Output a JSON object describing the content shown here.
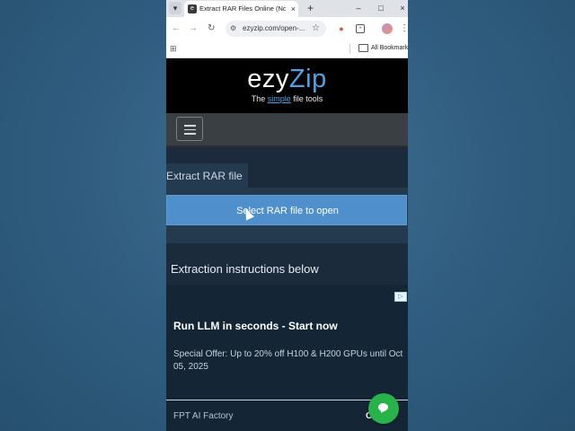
{
  "browser": {
    "tab": {
      "favicon_text": "e",
      "title": "Extract RAR Files Online (No Re",
      "close_glyph": "×"
    },
    "new_tab_glyph": "+",
    "window_controls": {
      "minimize": "–",
      "maximize": "□",
      "close": "×"
    },
    "address": {
      "url": "ezyzip.com/open-..."
    },
    "bookmarks": {
      "all_bookmarks_label": "All Bookmarks"
    }
  },
  "site": {
    "logo": {
      "ezy": "ezy",
      "zip": "Zip"
    },
    "tagline": {
      "prefix": "The ",
      "simple": "simple",
      "suffix": " file tools"
    },
    "tab_label": "Extract RAR file",
    "select_button_label": "Select RAR file to open",
    "instructions_heading": "Extraction instructions below"
  },
  "ad": {
    "title": "Run LLM in seconds - Start now",
    "body": "Special Offer: Up to 20% off H100 & H200 GPUs until Oct 05, 2025",
    "brand": "FPT AI Factory",
    "cta": "Open"
  },
  "colors": {
    "page_bg": "#2f5c7e",
    "site_bg": "#1b2b3c",
    "button_blue": "#4f8fcb",
    "logo_accent": "#4da3e8",
    "chat_green": "#27b24a"
  },
  "icons": [
    "chevron-down-icon",
    "favicon-icon",
    "close-icon",
    "plus-icon",
    "back-icon",
    "forward-icon",
    "reload-icon",
    "tune-icon",
    "star-icon",
    "extension-icon",
    "puzzle-icon",
    "avatar",
    "kebab-icon",
    "apps-icon",
    "folder-icon",
    "hamburger-icon",
    "adchoices-icon",
    "chat-icon",
    "cursor-icon"
  ]
}
